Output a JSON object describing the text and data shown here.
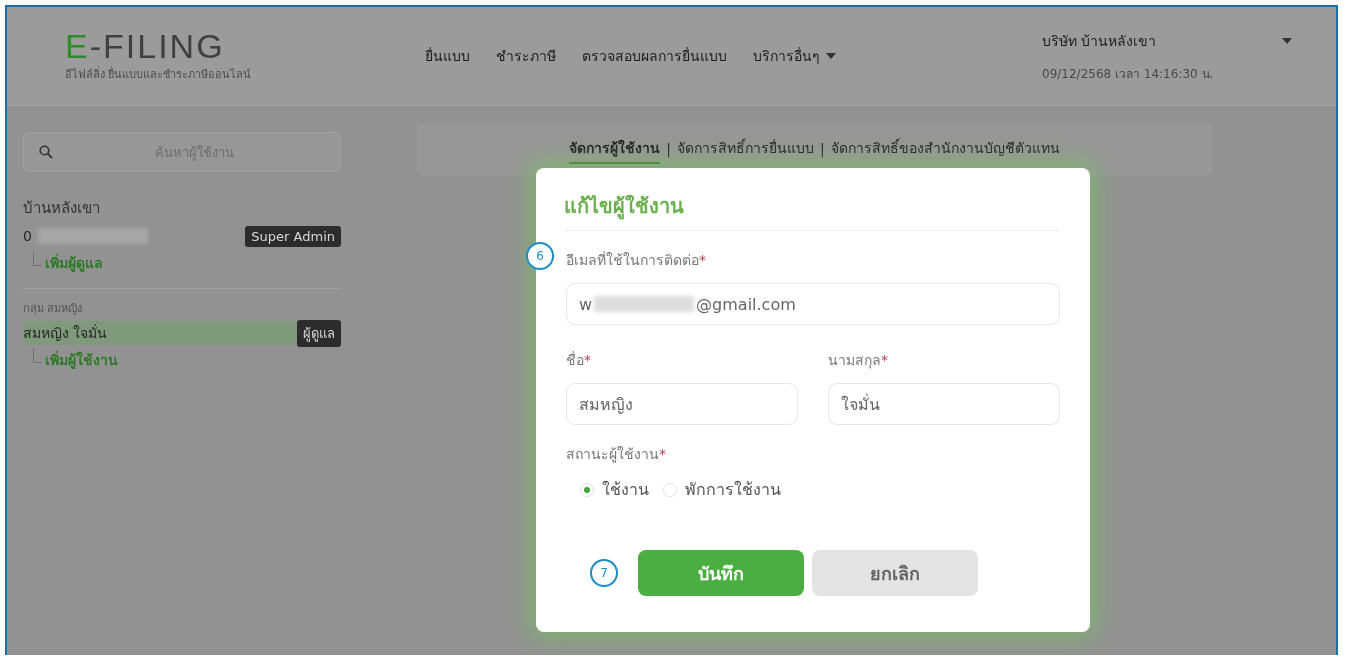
{
  "header": {
    "logo_title": "E-FILING",
    "logo_subtitle": "อีไฟล์ลิ่ง ยื่นแบบและชำระภาษีออนไลน์",
    "nav": [
      {
        "label": "ยื่นแบบ",
        "dropdown": false
      },
      {
        "label": "ชำระภาษี",
        "dropdown": false
      },
      {
        "label": "ตรวจสอบผลการยื่นแบบ",
        "dropdown": false
      },
      {
        "label": "บริการอื่นๆ",
        "dropdown": true
      }
    ],
    "user": {
      "name": "บริษัท บ้านหลังเขา",
      "datetime": "09/12/2568 เวลา 14:16:30 น."
    }
  },
  "sidebar": {
    "search": {
      "placeholder": "ค้นหาผู้ใช้งาน"
    },
    "groups": [
      {
        "caption": "บ้านหลังเขา",
        "kind": "title",
        "member": {
          "name": "0",
          "redacted": true,
          "badge": "Super Admin",
          "selected": false
        },
        "child_link": "เพิ่มผู้ดูแล"
      },
      {
        "caption": "กลุ่ม สมหญิง",
        "kind": "subtitle",
        "member": {
          "name": "สมหญิง ใจมั่น",
          "redacted": false,
          "badge": "ผู้ดูแล",
          "selected": true
        },
        "child_link": "เพิ่มผู้ใช้งาน"
      }
    ]
  },
  "tabs": [
    {
      "kind": "tab",
      "label": "จัดการผู้ใช้งาน",
      "selected": true
    },
    {
      "kind": "separator",
      "label": "|"
    },
    {
      "kind": "tab",
      "label": "จัดการสิทธิ์การยื่นแบบ",
      "selected": false
    },
    {
      "kind": "separator",
      "label": "|"
    },
    {
      "kind": "tab",
      "label": "จัดการสิทธิ์ของสำนักงานบัญชีตัวแทน",
      "selected": false
    }
  ],
  "dialog": {
    "title": "แก้ไขผู้ใช้งาน",
    "email": {
      "label": "อีเมลที่ใช้ในการติดต่อ",
      "required_mark": "*",
      "value_start": "w",
      "value_end": "@gmail.com",
      "callout": "6"
    },
    "first_name": {
      "label": "ชื่อ",
      "required_mark": "*",
      "value": "สมหญิง"
    },
    "last_name": {
      "label": "นามสกุล",
      "required_mark": "*",
      "value": "ใจมั่น"
    },
    "status": {
      "label": "สถานะผู้ใช้งาน",
      "required_mark": "*",
      "options": [
        {
          "label": "ใช้งาน",
          "selected": true
        },
        {
          "label": "พักการใช้งาน",
          "selected": false
        }
      ]
    },
    "buttons": [
      {
        "kind": "primary",
        "label": "บันทึก"
      },
      {
        "kind": "secondary",
        "label": "ยกเลิก"
      }
    ],
    "buttons_callout": "7"
  }
}
